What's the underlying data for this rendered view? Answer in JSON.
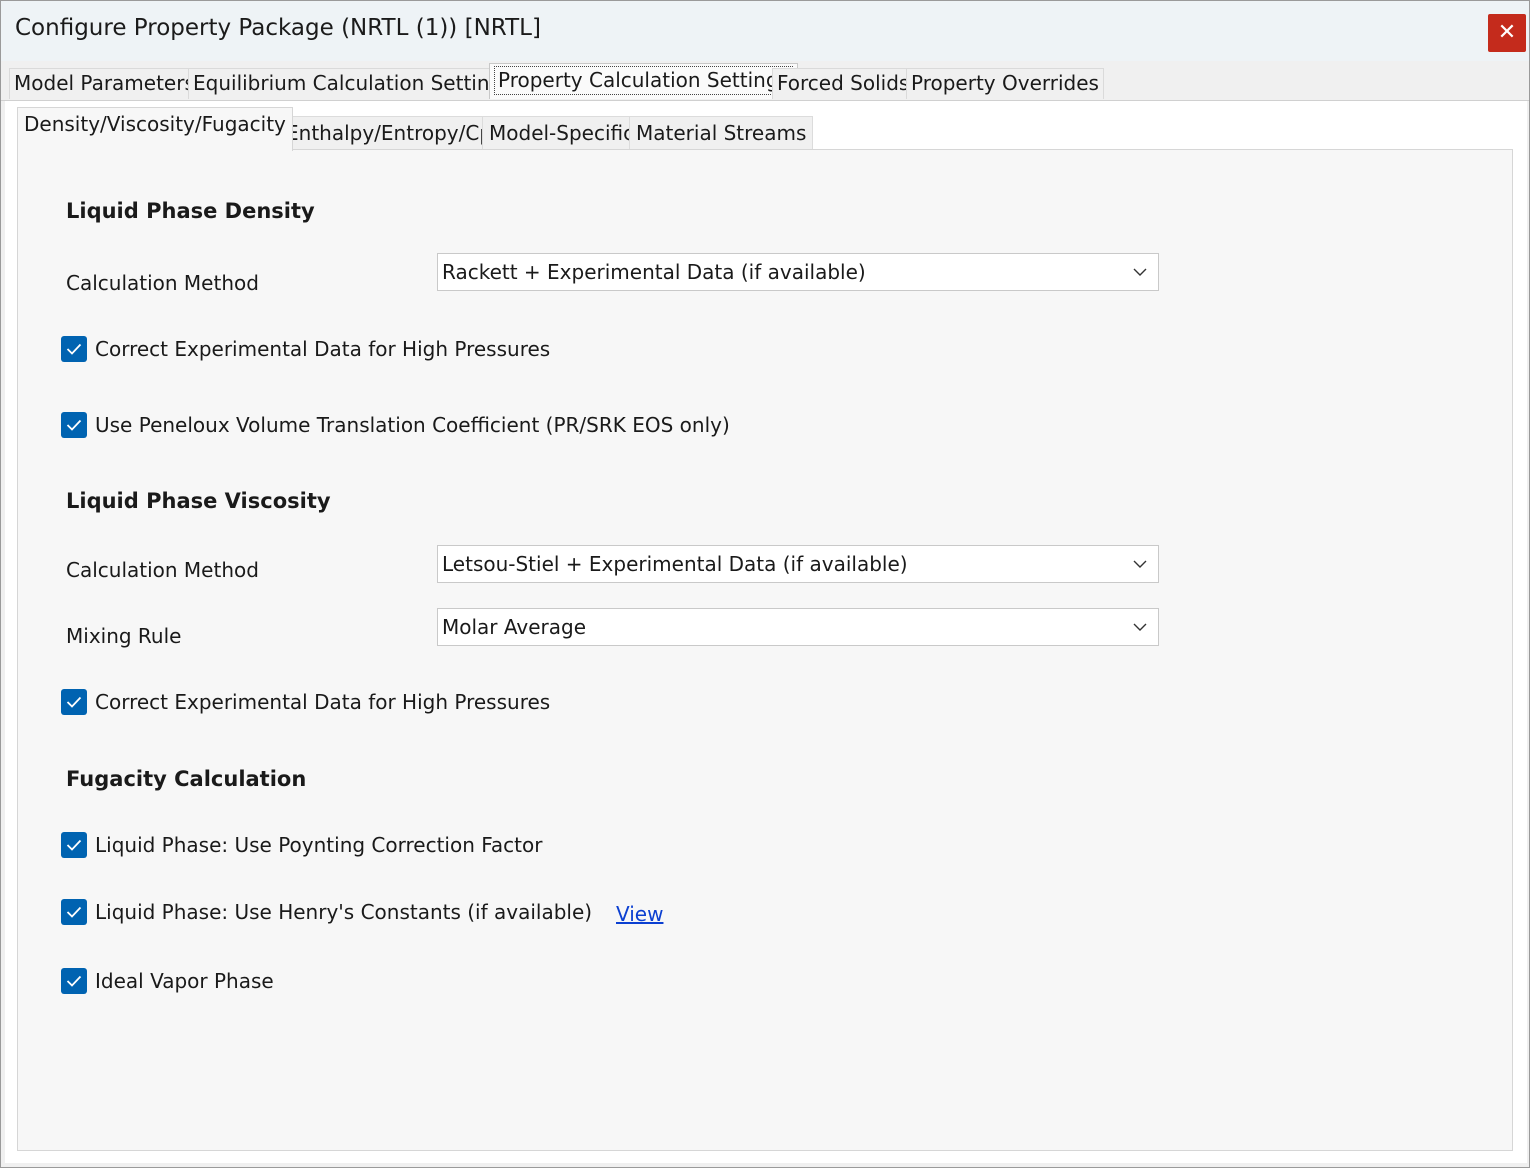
{
  "window": {
    "title": "Configure Property Package (NRTL (1)) [NRTL]",
    "close_glyph": "✕"
  },
  "outer_tabs": [
    {
      "label": "Model Parameters"
    },
    {
      "label": "Equilibrium Calculation Settings"
    },
    {
      "label": "Property Calculation Settings"
    },
    {
      "label": "Forced Solids"
    },
    {
      "label": "Property Overrides"
    }
  ],
  "inner_tabs": [
    {
      "label": "Density/Viscosity/Fugacity"
    },
    {
      "label": "Enthalpy/Entropy/Cp"
    },
    {
      "label": "Model-Specific"
    },
    {
      "label": "Material Streams"
    }
  ],
  "liquid_density": {
    "title": "Liquid Phase Density",
    "calc_method_label": "Calculation Method",
    "calc_method_value": "Rackett + Experimental Data (if available)",
    "correct_high_pressure": {
      "label": "Correct Experimental Data for High Pressures",
      "checked": true
    },
    "peneloux": {
      "label": "Use Peneloux Volume Translation Coefficient (PR/SRK EOS only)",
      "checked": true
    }
  },
  "liquid_viscosity": {
    "title": "Liquid Phase Viscosity",
    "calc_method_label": "Calculation Method",
    "calc_method_value": "Letsou-Stiel + Experimental Data (if available)",
    "mixing_rule_label": "Mixing Rule",
    "mixing_rule_value": "Molar Average",
    "correct_high_pressure": {
      "label": "Correct Experimental Data for High Pressures",
      "checked": true
    }
  },
  "fugacity": {
    "title": "Fugacity Calculation",
    "poynting": {
      "label": "Liquid Phase: Use Poynting Correction Factor",
      "checked": true
    },
    "henry": {
      "label": "Liquid Phase: Use Henry's Constants (if available)",
      "checked": true
    },
    "henry_view_link": "View",
    "ideal_vapor": {
      "label": "Ideal Vapor Phase",
      "checked": true
    }
  },
  "colors": {
    "accent": "#0063b1",
    "close": "#c42b1c",
    "link": "#0b3fd1"
  }
}
